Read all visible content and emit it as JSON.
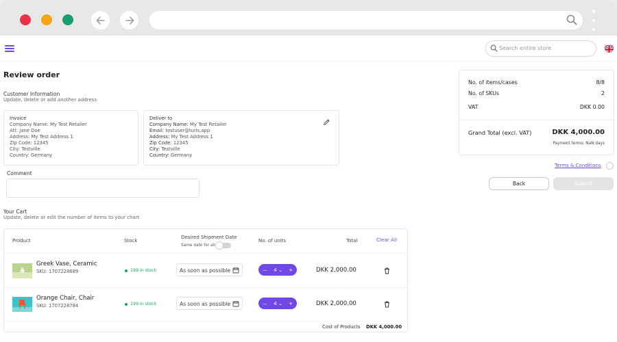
{
  "browser": {
    "dots": [
      "red",
      "yellow",
      "green"
    ],
    "url": ""
  },
  "header": {
    "search_placeholder": "Search entire store"
  },
  "page": {
    "title": "Review order",
    "customer_info": {
      "heading": "Customer Information",
      "subheading": "Update, delete or add another address"
    },
    "invoice": {
      "title": "Invoice",
      "lines": [
        "Company Name: My Test Retailer",
        "Att: Jane Doe",
        "Address: My Test Address 1",
        "Zip Code: 12345",
        "City: Testville",
        "Country: Germany"
      ]
    },
    "deliver": {
      "title": "Deliver to",
      "lines": [
        {
          "k": "Company Name:",
          "v": "My Test Retailer"
        },
        {
          "k": "Email:",
          "v": "testuser@turis.app"
        },
        {
          "k": "Address:",
          "v": "My Test Address 1"
        },
        {
          "k": "Zip Code:",
          "v": "12345"
        },
        {
          "k": "City:",
          "v": "Testville"
        },
        {
          "k": "Country:",
          "v": "Germany"
        }
      ]
    },
    "comment_label": "Comment",
    "cart": {
      "heading": "Your Cart",
      "subheading": "Update, delete or edit the number of items to your chart",
      "columns": {
        "product": "Product",
        "stock": "Stock",
        "shipment": "Desired Shipment Date",
        "same_date": "Same date for all",
        "units": "No. of units",
        "total": "Total",
        "clear_all": "Clear All"
      },
      "items": [
        {
          "name": "Greek Vase, Ceramic",
          "sku": "SKU: 1707228689",
          "stock": "199 in stock",
          "ship": "As soon as possible",
          "qty": "4",
          "total": "DKK  2,000.00"
        },
        {
          "name": "Orange Chair, Chair",
          "sku": "SKU: 1707228784",
          "stock": "199 in stock",
          "ship": "As soon as possible",
          "qty": "4",
          "total": "DKK  2,000.00"
        }
      ],
      "cost_label": "Cost of Products",
      "cost_value": "DKK  4,000.00"
    },
    "summary": {
      "items_label": "No. of items/cases",
      "items_value": "8/8",
      "skus_label": "No. of SKUs",
      "skus_value": "2",
      "vat_label": "VAT",
      "vat_value": "DKK  0.00",
      "grand_label": "Grand Total (excl. VAT)",
      "grand_value": "DKK  4,000.00",
      "payment_terms": "Payment terms: NaN days"
    },
    "terms_label": "Terms & Conditions",
    "back_label": "Back",
    "submit_label": "Submit"
  },
  "colors": {
    "accent": "#6a4cd6",
    "stepper": "#7048e8",
    "in_stock": "#1a9e5a"
  }
}
